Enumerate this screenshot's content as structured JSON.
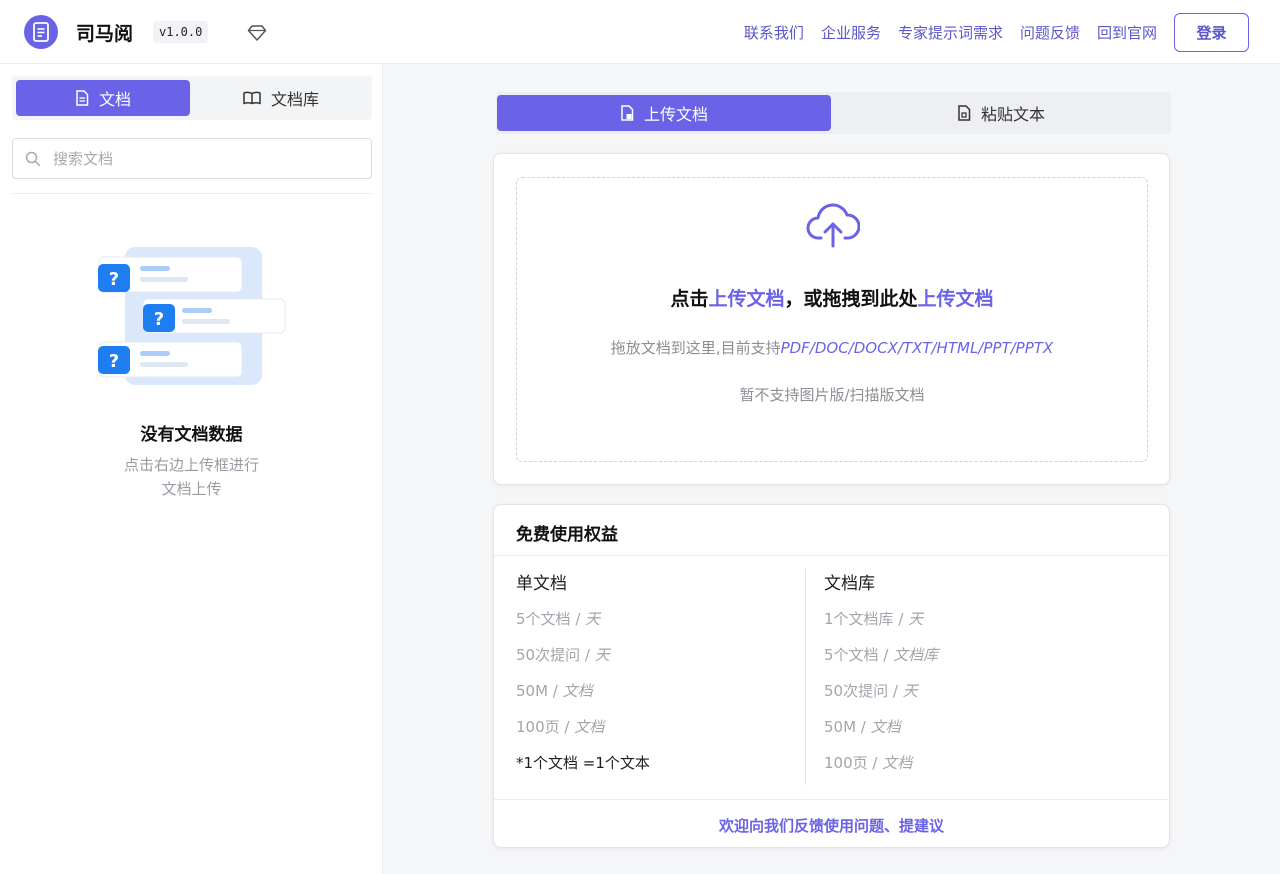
{
  "header": {
    "app_name": "司马阅",
    "version": "v1.0.0",
    "nav": [
      "联系我们",
      "企业服务",
      "专家提示词需求",
      "问题反馈",
      "回到官网"
    ],
    "login_label": "登录",
    "accent_color": "#6a63e8"
  },
  "sidebar": {
    "tabs": [
      {
        "label": "文档",
        "icon": "document-icon",
        "active": true
      },
      {
        "label": "文档库",
        "icon": "book-icon",
        "active": false
      }
    ],
    "search": {
      "placeholder": "搜索文档",
      "value": ""
    },
    "empty": {
      "title": "没有文档数据",
      "desc_line1": "点击右边上传框进行",
      "desc_line2": "文档上传"
    }
  },
  "main": {
    "tabs": [
      {
        "label": "上传文档",
        "icon": "upload-file-icon",
        "active": true
      },
      {
        "label": "粘贴文本",
        "icon": "paste-icon",
        "active": false
      }
    ],
    "upload": {
      "title_part1": "点击",
      "title_link1": "上传文档",
      "title_part2": "，或拖拽到此处",
      "title_link2": "上传文档",
      "formats_prefix": "拖放文档到这里,目前支持",
      "formats": "PDF/DOC/DOCX/TXT/HTML/PPT/PPTX",
      "note": "暂不支持图片版/扫描版文档"
    },
    "benefits": {
      "title": "免费使用权益",
      "single": {
        "title": "单文档",
        "items": [
          {
            "amount": "5个文档",
            "unit": "天"
          },
          {
            "amount": "50次提问",
            "unit": "天"
          },
          {
            "amount": "50M",
            "unit": "文档"
          },
          {
            "amount": "100页",
            "unit": "文档"
          }
        ],
        "note": "*1个文档 =1个文本"
      },
      "library": {
        "title": "文档库",
        "items": [
          {
            "amount": "1个文档库",
            "unit": "天"
          },
          {
            "amount": "5个文档",
            "unit": "文档库"
          },
          {
            "amount": "50次提问",
            "unit": "天"
          },
          {
            "amount": "50M",
            "unit": "文档"
          },
          {
            "amount": "100页",
            "unit": "文档"
          }
        ]
      },
      "feedback": "欢迎向我们反馈使用问题、提建议"
    }
  }
}
